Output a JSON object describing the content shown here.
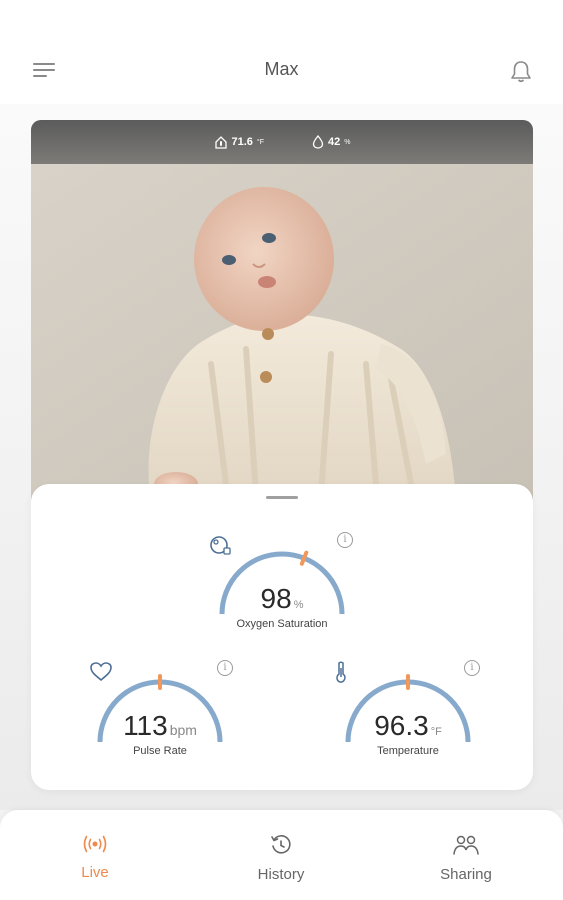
{
  "header": {
    "title": "Max"
  },
  "camera": {
    "temperature": "71.6",
    "temperature_unit": "°F",
    "humidity": "42",
    "humidity_unit": "%"
  },
  "vitals": {
    "oxygen": {
      "value": "98",
      "unit": "%",
      "label": "Oxygen Saturation",
      "level": 0.62,
      "icon": "oxygen-icon"
    },
    "pulse": {
      "value": "113",
      "unit": "bpm",
      "label": "Pulse Rate",
      "level": 0.5,
      "icon": "heart-icon"
    },
    "temperature": {
      "value": "96.3",
      "unit": "°F",
      "label": "Temperature",
      "level": 0.5,
      "icon": "thermometer-icon"
    }
  },
  "nav": {
    "items": [
      {
        "label": "Live",
        "icon": "live-broadcast-icon",
        "active": true
      },
      {
        "label": "History",
        "icon": "history-icon",
        "active": false
      },
      {
        "label": "Sharing",
        "icon": "sharing-icon",
        "active": false
      }
    ]
  },
  "colors": {
    "accent": "#ee8a4d",
    "gauge_arc": "#86a9cc",
    "marker": "#f2975a"
  }
}
